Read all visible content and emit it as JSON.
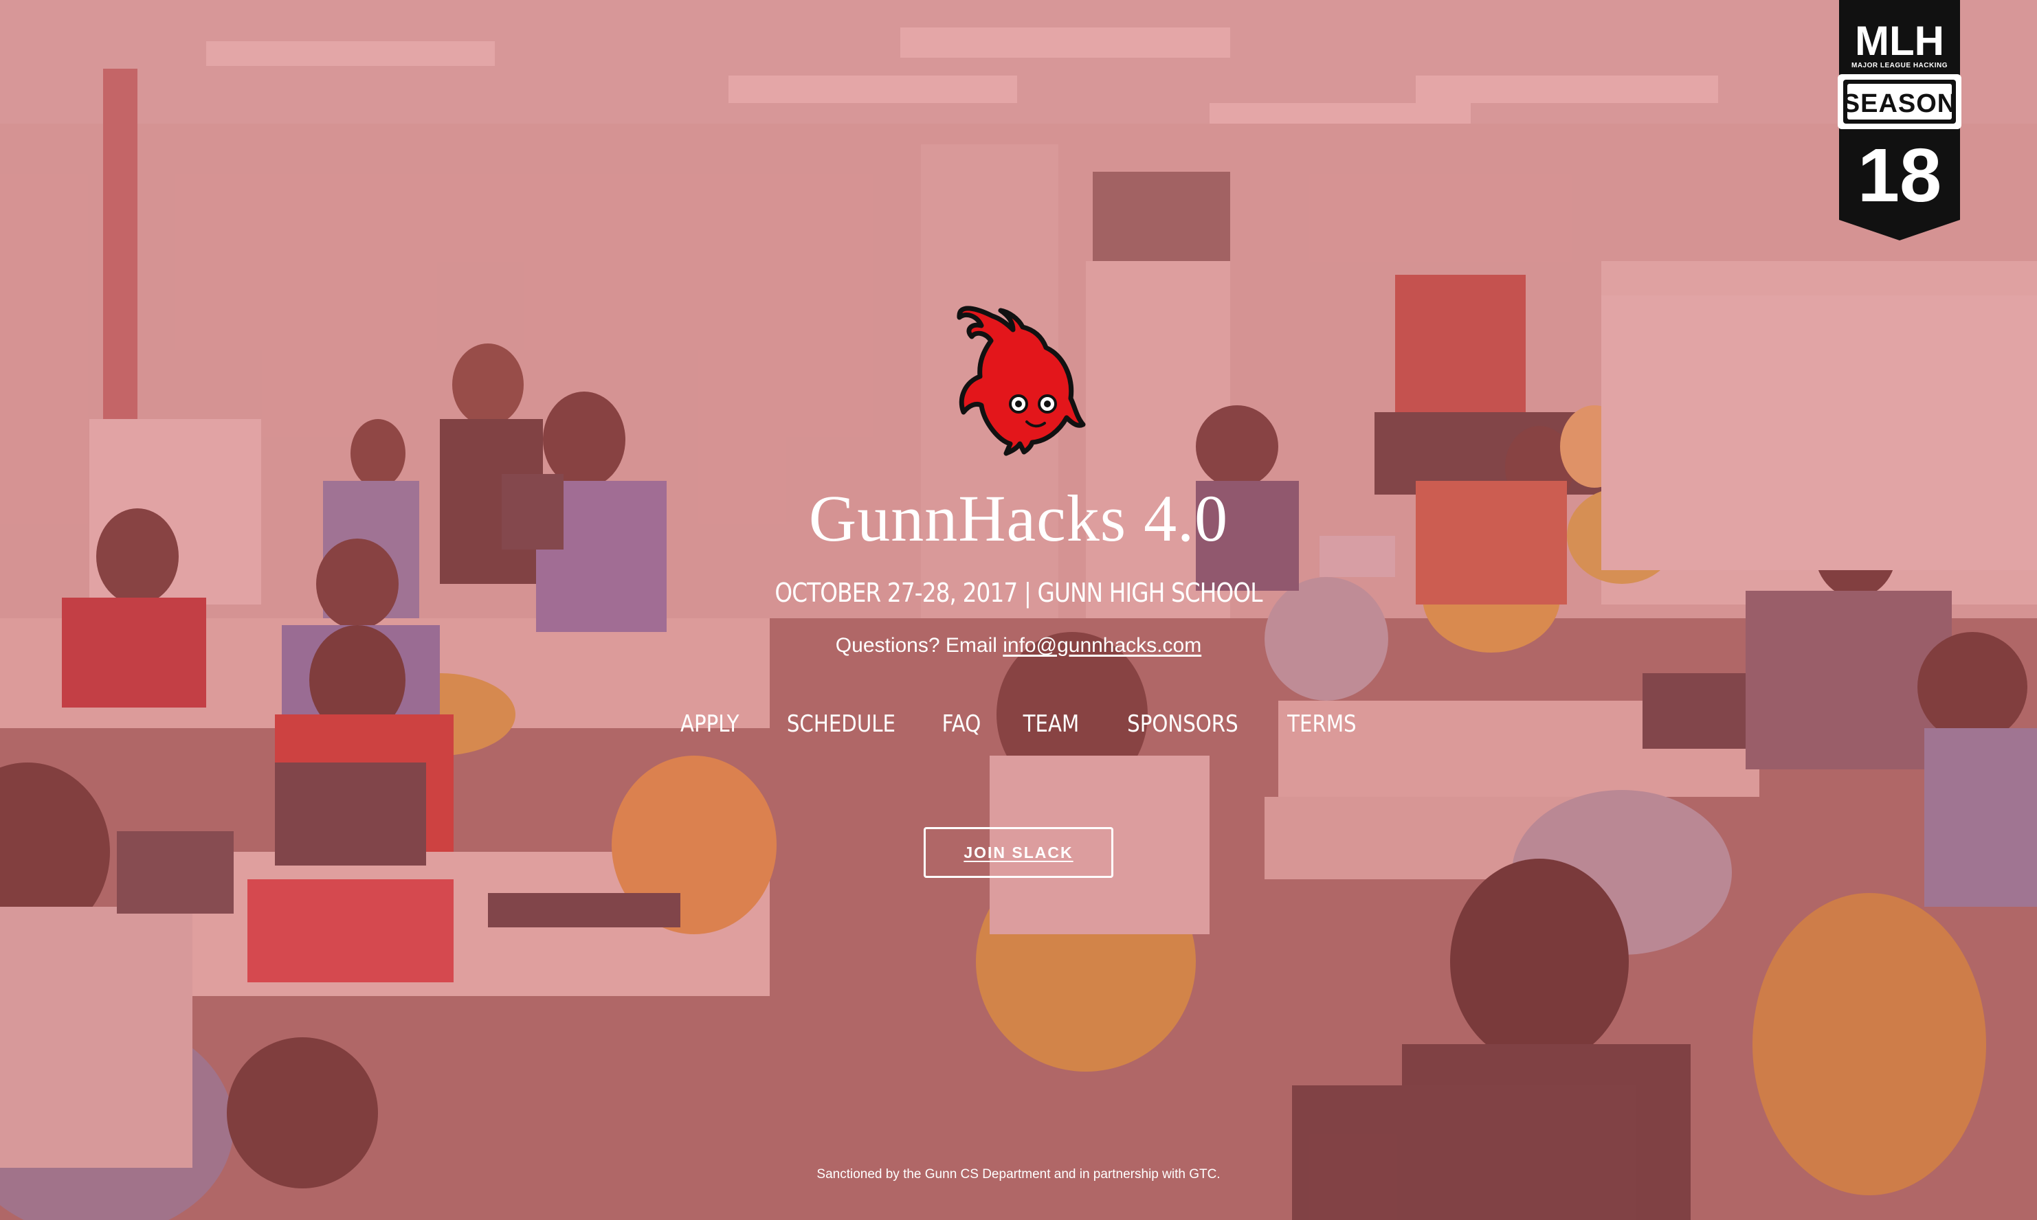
{
  "colors": {
    "overlay": "#d66064",
    "mascot_red": "#e3161b",
    "badge_black": "#111111",
    "text": "#ffffff"
  },
  "badge": {
    "logo": "MLH",
    "tagline": "MAJOR LEAGUE HACKING",
    "season_label": "SEASON",
    "season_number": "18"
  },
  "mascot": {
    "icon": "red-flame-mascot-icon"
  },
  "hero": {
    "title": "GunnHacks 4.0",
    "subtitle": "OCTOBER 27-28, 2017 | GUNN HIGH SCHOOL",
    "questions_prefix": "Questions? Email ",
    "email": "info@gunnhacks.com"
  },
  "nav": {
    "items": [
      "APPLY",
      "SCHEDULE",
      "FAQ",
      "TEAM",
      "SPONSORS",
      "TERMS"
    ]
  },
  "cta": {
    "join_label": "JOIN SLACK"
  },
  "footer": {
    "text": "Sanctioned by the Gunn CS Department and in partnership with GTC."
  }
}
